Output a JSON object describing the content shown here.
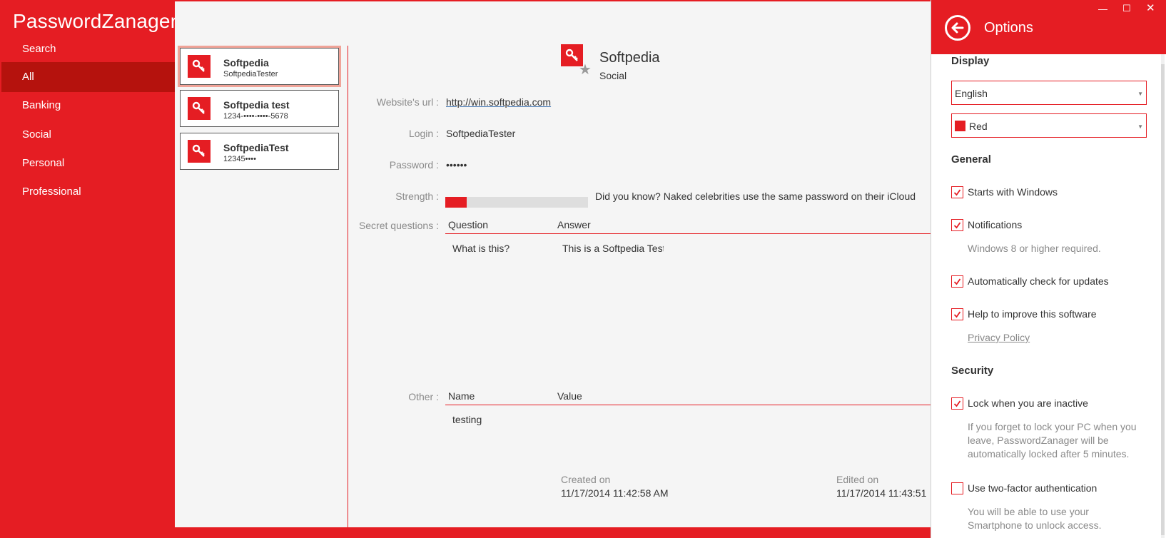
{
  "app": {
    "title": "PasswordZanager"
  },
  "sidebar": {
    "items": [
      {
        "label": "Search"
      },
      {
        "label": "All"
      },
      {
        "label": "Banking"
      },
      {
        "label": "Social"
      },
      {
        "label": "Personal"
      },
      {
        "label": "Professional"
      }
    ]
  },
  "entries": [
    {
      "name": "Softpedia",
      "sub": "SoftpediaTester"
    },
    {
      "name": "Softpedia test",
      "sub": "1234-••••-••••-5678"
    },
    {
      "name": "SoftpediaTest",
      "sub": "12345••••"
    }
  ],
  "detail": {
    "title": "Softpedia",
    "category": "Social",
    "url_label": "Website's url :",
    "url": "http://win.softpedia.com",
    "login_label": "Login :",
    "login": "SoftpediaTester",
    "password_label": "Password :",
    "password": "••••••",
    "strength_label": "Strength :",
    "strength_fraction": 0.15,
    "tip": "Did you know? Naked celebrities use the same password on their iCloud",
    "questions_label": "Secret questions :",
    "questions_head": {
      "question": "Question",
      "answer": "Answer"
    },
    "questions": [
      {
        "question": "What is this?",
        "answer": "This is a Softpedia Test"
      }
    ],
    "other_label": "Other :",
    "other_head": {
      "name": "Name",
      "value": "Value"
    },
    "other": [
      {
        "name": "testing",
        "value": ""
      }
    ],
    "created_label": "Created on",
    "created": "11/17/2014 11:42:58 AM",
    "edited_label": "Edited on",
    "edited": "11/17/2014 11:43:51"
  },
  "options": {
    "title": "Options",
    "display_title": "Display",
    "language": "English",
    "color": "Red",
    "general_title": "General",
    "starts_with_windows": "Starts with Windows",
    "notifications": "Notifications",
    "notifications_note": "Windows 8 or higher required.",
    "auto_update": "Automatically check for updates",
    "improve": "Help to improve this software",
    "privacy": "Privacy Policy",
    "security_title": "Security",
    "lock_inactive": "Lock when you are inactive",
    "lock_note": "If you forget to lock your PC when you leave, PasswordZanager will be automatically locked after 5 minutes.",
    "two_factor": "Use two-factor authentication",
    "two_factor_note": "You will be able to use your Smartphone to unlock access.",
    "checks": {
      "starts": true,
      "notifications": true,
      "updates": true,
      "improve": true,
      "lock": true,
      "two_factor": false
    }
  },
  "colors": {
    "accent": "#e51d23",
    "accent_dark": "#b5120d",
    "selection": "#f0a398"
  }
}
